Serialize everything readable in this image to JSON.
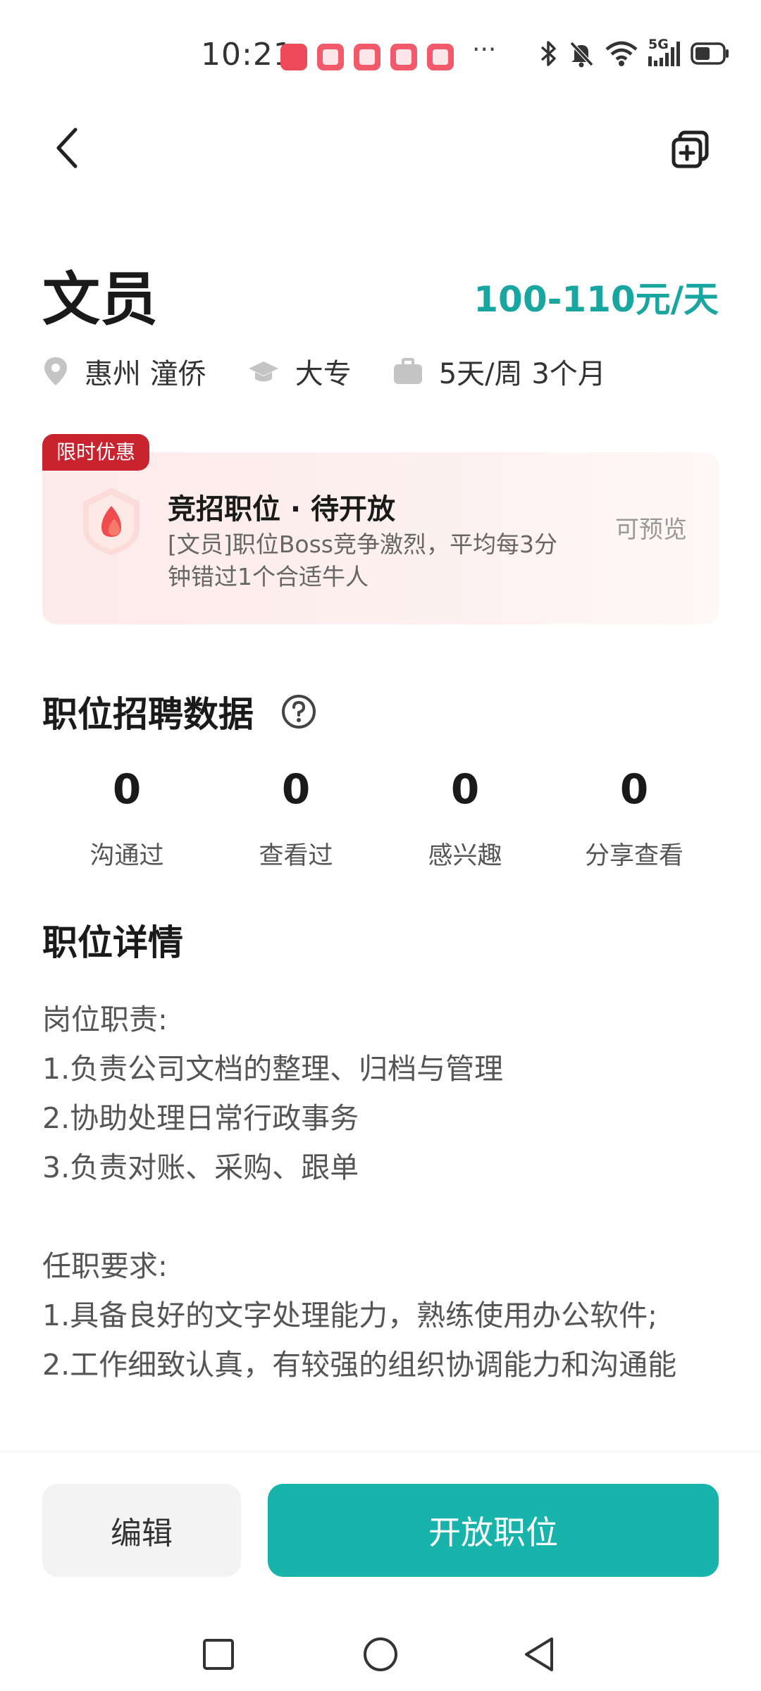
{
  "status_bar": {
    "time": "10:21",
    "more": "···",
    "network": "5G",
    "icons": [
      "huawei-app-icon",
      "app-notification-icon",
      "bluetooth-icon",
      "mute-icon",
      "wifi-icon",
      "signal-icon",
      "battery-icon"
    ]
  },
  "nav": {
    "back_icon": "back-arrow-icon",
    "copy_icon": "add-copy-icon"
  },
  "job": {
    "title": "文员",
    "salary": "100-110元/天",
    "location": "惠州 潼侨",
    "education": "大专",
    "schedule": "5天/周 3个月"
  },
  "promo": {
    "tag": "限时优惠",
    "title": "竞招职位 · 待开放",
    "description": "[文员]职位Boss竞争激烈，平均每3分钟错过1个合适牛人",
    "preview": "可预览",
    "accent": "#c9232f"
  },
  "stats_section": {
    "title": "职位招聘数据",
    "items": [
      {
        "value": "0",
        "label": "沟通过"
      },
      {
        "value": "0",
        "label": "查看过"
      },
      {
        "value": "0",
        "label": "感兴趣"
      },
      {
        "value": "0",
        "label": "分享查看"
      }
    ]
  },
  "details_section": {
    "title": "职位详情",
    "text": "岗位职责:\n1.负责公司文档的整理、归档与管理\n2.协助处理日常行政事务\n3.负责对账、采购、跟单\n\n任职要求:\n1.具备良好的文字处理能力，熟练使用办公软件;\n2.工作细致认真，有较强的组织协调能力和沟通能"
  },
  "actions": {
    "edit_label": "编辑",
    "open_label": "开放职位",
    "primary_color": "#18b3ab"
  },
  "system_nav": {
    "icons": [
      "recent-apps-icon",
      "home-icon",
      "back-icon"
    ]
  }
}
